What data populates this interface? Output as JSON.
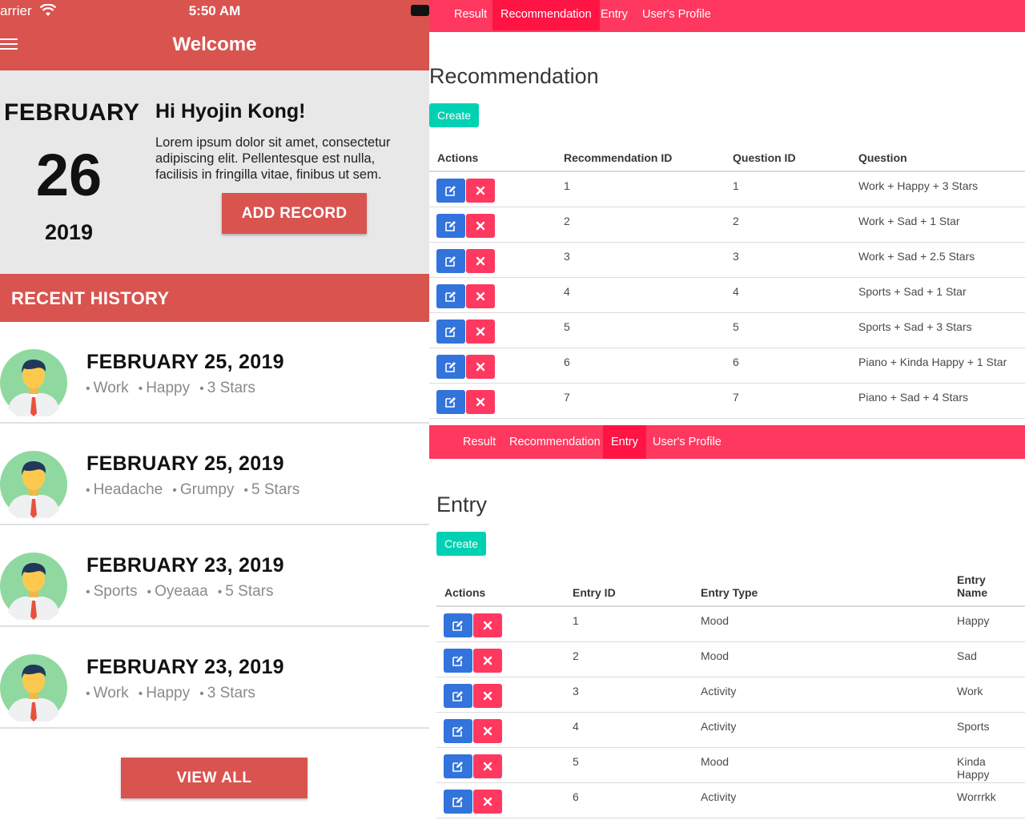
{
  "phone": {
    "status": {
      "carrier": "arrier",
      "time": "5:50 AM"
    },
    "navbar": {
      "title": "Welcome"
    },
    "hero": {
      "month": "FEBRUARY",
      "day": "26",
      "year": "2019",
      "greeting": "Hi Hyojin Kong!",
      "body": "Lorem ipsum dolor sit amet, consectetur adipiscing elit. Pellentesque est nulla, facilisis in fringilla vitae, finibus ut sem.",
      "add_record_label": "ADD RECORD"
    },
    "recent": {
      "title": "RECENT HISTORY",
      "items": [
        {
          "date": "FEBRUARY 25, 2019",
          "tags": [
            "Work",
            "Happy",
            "3 Stars"
          ]
        },
        {
          "date": "FEBRUARY 25, 2019",
          "tags": [
            "Headache",
            "Grumpy",
            "5 Stars"
          ]
        },
        {
          "date": "FEBRUARY 23, 2019",
          "tags": [
            "Sports",
            "Oyeaaa",
            "5 Stars"
          ]
        },
        {
          "date": "FEBRUARY 23, 2019",
          "tags": [
            "Work",
            "Happy",
            "3 Stars"
          ]
        }
      ],
      "view_all_label": "VIEW ALL"
    },
    "colors": {
      "primary": "#d9534f",
      "hero_bg": "#e8e8e8"
    }
  },
  "recommendation_panel": {
    "nav": {
      "items": [
        "Result",
        "Recommendation",
        "Entry",
        "User's Profile"
      ],
      "active": "Recommendation"
    },
    "heading": "Recommendation",
    "create_label": "Create",
    "columns": [
      "Actions",
      "Recommendation ID",
      "Question ID",
      "Question"
    ],
    "rows": [
      [
        "1",
        "1",
        "Work + Happy + 3 Stars"
      ],
      [
        "2",
        "2",
        "Work + Sad + 1 Star"
      ],
      [
        "3",
        "3",
        "Work + Sad + 2.5 Stars"
      ],
      [
        "4",
        "4",
        "Sports + Sad + 1 Star"
      ],
      [
        "5",
        "5",
        "Sports + Sad + 3 Stars"
      ],
      [
        "6",
        "6",
        "Piano + Kinda Happy + 1 Star"
      ],
      [
        "7",
        "7",
        "Piano + Sad + 4 Stars"
      ]
    ]
  },
  "entry_panel": {
    "nav": {
      "items": [
        "Result",
        "Recommendation",
        "Entry",
        "User's Profile"
      ],
      "active": "Entry"
    },
    "heading": "Entry",
    "create_label": "Create",
    "columns": [
      "Actions",
      "Entry ID",
      "Entry Type",
      "Entry Name"
    ],
    "rows": [
      [
        "1",
        "Mood",
        "Happy"
      ],
      [
        "2",
        "Mood",
        "Sad"
      ],
      [
        "3",
        "Activity",
        "Work"
      ],
      [
        "4",
        "Activity",
        "Sports"
      ],
      [
        "5",
        "Mood",
        "Kinda Happy"
      ],
      [
        "6",
        "Activity",
        "Worrrkk"
      ]
    ]
  },
  "icons": {
    "edit": "edit-icon",
    "delete": "close-icon",
    "avatar": "user-avatar",
    "menu": "hamburger-menu-icon",
    "wifi": "wifi-icon",
    "battery": "battery-icon"
  },
  "colors": {
    "nav_bg": "#ff3860",
    "nav_active": "#ff1444",
    "create": "#00d1b2",
    "edit": "#3273dc",
    "delete": "#ff3860"
  }
}
